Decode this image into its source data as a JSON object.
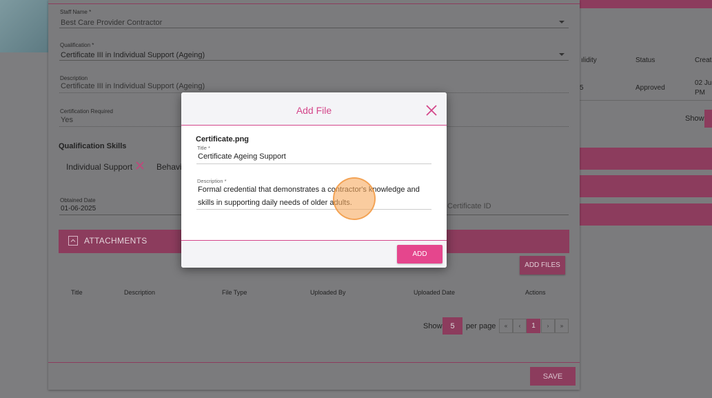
{
  "form": {
    "staff_name_label": "Staff Name *",
    "staff_name_value": "Best Care Provider Contractor",
    "qualification_label": "Qualification *",
    "qualification_value": "Certificate III in Individual Support (Ageing)",
    "description_label": "Description",
    "description_value": "Certificate III in Individual Support (Ageing)",
    "cert_required_label": "Certification Required",
    "cert_required_value": "Yes",
    "skills_heading": "Qualification Skills",
    "skills": [
      "Individual Support",
      "Behavi"
    ],
    "obtained_date_label": "Obtained Date",
    "obtained_date_value": "01-06-2025",
    "certificate_id_placeholder": "Certificate ID"
  },
  "attachments": {
    "title": "ATTACHMENTS",
    "add_files_label": "ADD FILES",
    "columns": [
      "Title",
      "Description",
      "File Type",
      "Uploaded By",
      "Uploaded Date",
      "Actions"
    ],
    "pagination": {
      "show_label": "Show",
      "page_size": "5",
      "per_page_label": "per page",
      "first": "«",
      "prev": "‹",
      "current": "1",
      "next": "›",
      "last": "»"
    }
  },
  "footer": {
    "save_label": "SAVE"
  },
  "background_table": {
    "col_validity": "ılidity",
    "col_status": "Status",
    "col_created": "Create",
    "row_validity": "5",
    "row_status": "Approved",
    "row_created_line1": "02 Ju",
    "row_created_line2": "PM",
    "show_label": "Show"
  },
  "modal": {
    "title": "Add File",
    "file_name": "Certificate.png",
    "title_label": "Title *",
    "title_value": "Certificate Ageing Support",
    "description_label": "Description *",
    "description_value": "Formal credential that demonstrates a contractor's knowledge and skills in supporting daily needs of older adults.",
    "add_label": "ADD"
  },
  "colors": {
    "accent": "#e5468d",
    "accent_dimmed": "#8c3c5d",
    "modal_title": "#d4468a"
  }
}
